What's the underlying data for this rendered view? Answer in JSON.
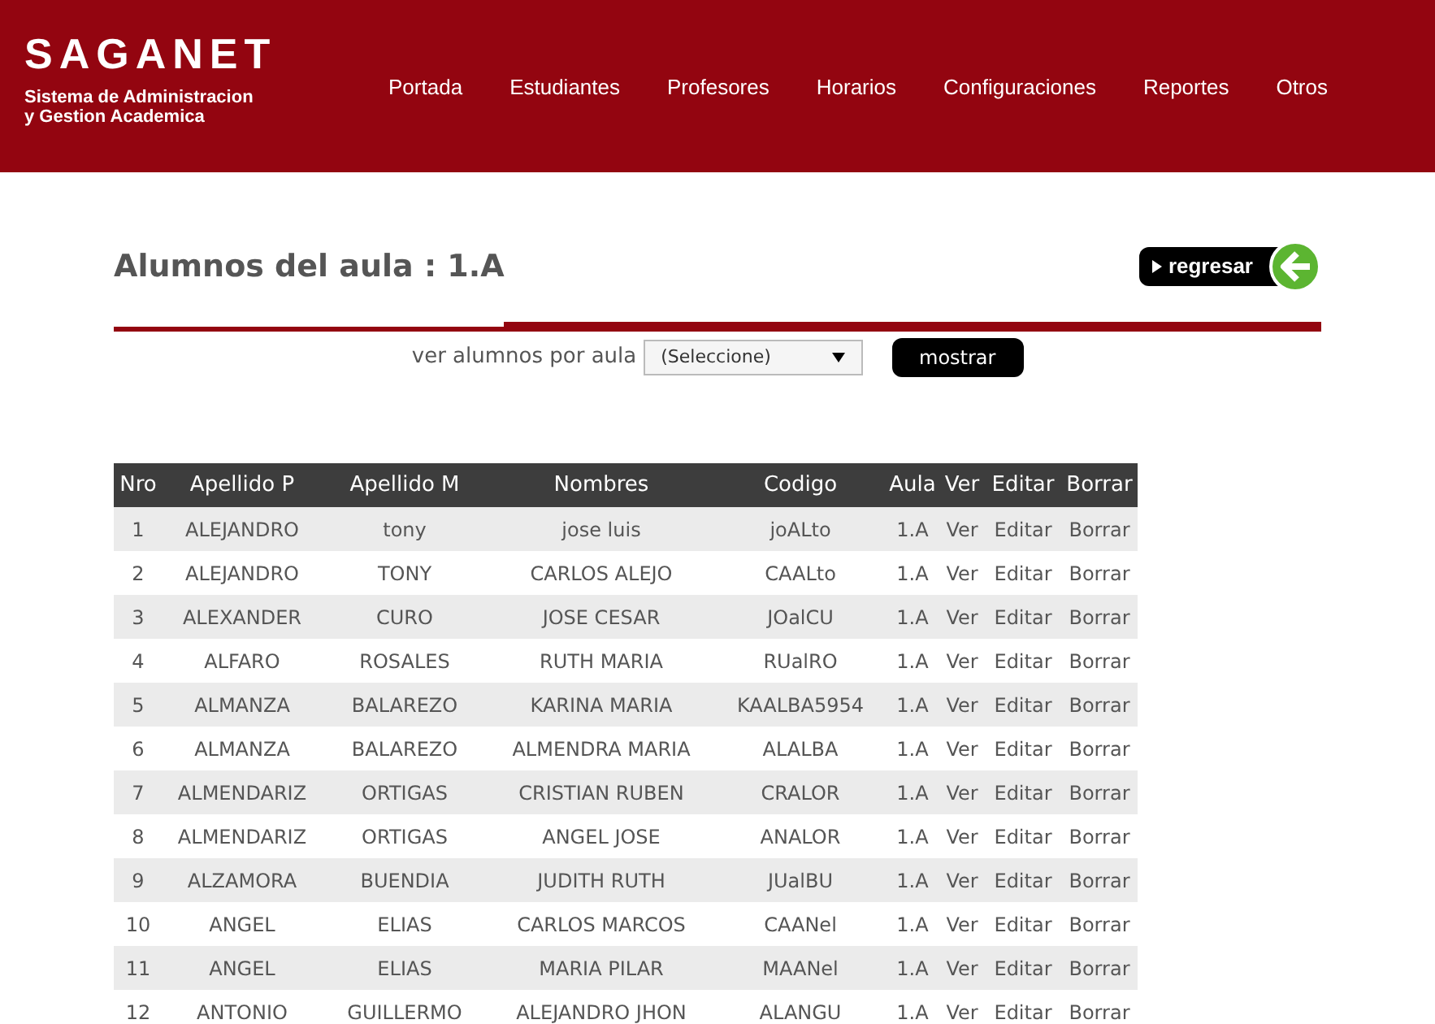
{
  "logo": {
    "name": "SAGANET",
    "tagline_1": "Sistema de Administracion",
    "tagline_2": "y Gestion Academica"
  },
  "nav": [
    "Portada",
    "Estudiantes",
    "Profesores",
    "Horarios",
    "Configuraciones",
    "Reportes",
    "Otros"
  ],
  "page_title": "Alumnos del aula : 1.A",
  "back_button": "regresar",
  "filter": {
    "label": "ver alumnos por aula",
    "select_value": "(Seleccione)",
    "button": "mostrar"
  },
  "table": {
    "columns": [
      "Nro",
      "Apellido P",
      "Apellido M",
      "Nombres",
      "Codigo",
      "Aula",
      "Ver",
      "Editar",
      "Borrar"
    ],
    "rows": [
      [
        "1",
        "ALEJANDRO",
        "tony",
        "jose luis",
        "joALto",
        "1.A",
        "Ver",
        "Editar",
        "Borrar"
      ],
      [
        "2",
        "ALEJANDRO",
        "TONY",
        "CARLOS ALEJO",
        "CAALto",
        "1.A",
        "Ver",
        "Editar",
        "Borrar"
      ],
      [
        "3",
        "ALEXANDER",
        "CURO",
        "JOSE CESAR",
        "JOalCU",
        "1.A",
        "Ver",
        "Editar",
        "Borrar"
      ],
      [
        "4",
        "ALFARO",
        "ROSALES",
        "RUTH MARIA",
        "RUalRO",
        "1.A",
        "Ver",
        "Editar",
        "Borrar"
      ],
      [
        "5",
        "ALMANZA",
        "BALAREZO",
        "KARINA MARIA",
        "KAALBA5954",
        "1.A",
        "Ver",
        "Editar",
        "Borrar"
      ],
      [
        "6",
        "ALMANZA",
        "BALAREZO",
        "ALMENDRA MARIA",
        "ALALBA",
        "1.A",
        "Ver",
        "Editar",
        "Borrar"
      ],
      [
        "7",
        "ALMENDARIZ",
        "ORTIGAS",
        "CRISTIAN RUBEN",
        "CRALOR",
        "1.A",
        "Ver",
        "Editar",
        "Borrar"
      ],
      [
        "8",
        "ALMENDARIZ",
        "ORTIGAS",
        "ANGEL JOSE",
        "ANALOR",
        "1.A",
        "Ver",
        "Editar",
        "Borrar"
      ],
      [
        "9",
        "ALZAMORA",
        "BUENDIA",
        "JUDITH RUTH",
        "JUalBU",
        "1.A",
        "Ver",
        "Editar",
        "Borrar"
      ],
      [
        "10",
        "ANGEL",
        "ELIAS",
        "CARLOS MARCOS",
        "CAANel",
        "1.A",
        "Ver",
        "Editar",
        "Borrar"
      ],
      [
        "11",
        "ANGEL",
        "ELIAS",
        "MARIA PILAR",
        "MAANel",
        "1.A",
        "Ver",
        "Editar",
        "Borrar"
      ],
      [
        "12",
        "ANTONIO",
        "GUILLERMO",
        "ALEJANDRO JHON",
        "ALANGU",
        "1.A",
        "Ver",
        "Editar",
        "Borrar"
      ]
    ]
  }
}
